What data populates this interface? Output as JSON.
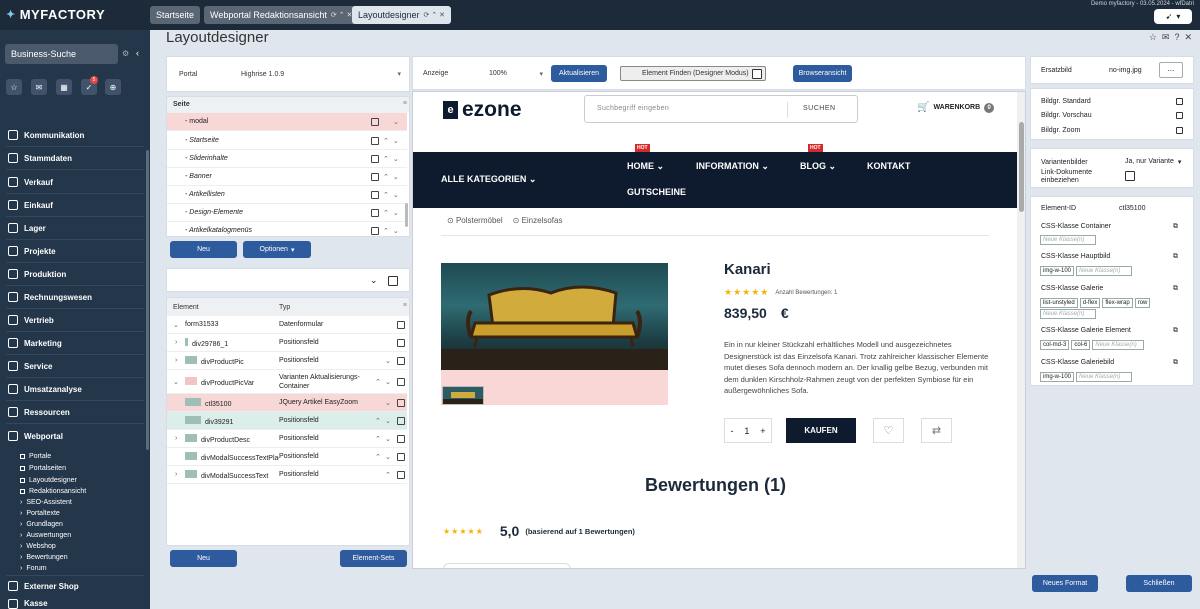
{
  "app": {
    "brand": "MYFACTORY",
    "demo_text": "Demo myfactory - 03.05.2024 - wfDatri"
  },
  "tabs": [
    {
      "label": "Startseite"
    },
    {
      "label": "Webportal Redaktionsansicht"
    },
    {
      "label": "Layoutdesigner"
    }
  ],
  "sidebar": {
    "search": "Business-Suche",
    "badge": "5",
    "items": [
      {
        "label": "Kommunikation"
      },
      {
        "label": "Stammdaten"
      },
      {
        "label": "Verkauf"
      },
      {
        "label": "Einkauf"
      },
      {
        "label": "Lager"
      },
      {
        "label": "Projekte"
      },
      {
        "label": "Produktion"
      },
      {
        "label": "Rechnungswesen"
      },
      {
        "label": "Vertrieb"
      },
      {
        "label": "Marketing"
      },
      {
        "label": "Service"
      },
      {
        "label": "Umsatzanalyse"
      },
      {
        "label": "Ressourcen"
      },
      {
        "label": "Webportal"
      }
    ],
    "subitems": [
      {
        "label": "Portale"
      },
      {
        "label": "Portalseiten"
      },
      {
        "label": "Layoutdesigner"
      },
      {
        "label": "Redaktionsansicht"
      },
      {
        "label": "SEO-Assistent"
      },
      {
        "label": "Portaltexte"
      },
      {
        "label": "Grundlagen"
      },
      {
        "label": "Auswertungen"
      },
      {
        "label": "Webshop"
      },
      {
        "label": "Bewertungen"
      },
      {
        "label": "Forum"
      }
    ],
    "extern": "Externer Shop",
    "last": "Kasse"
  },
  "page_title": "Layoutdesigner",
  "portal": {
    "label": "Portal",
    "value": "Highrise 1.0.9"
  },
  "anzeige": {
    "label": "Anzeige",
    "value": "100%",
    "refresh": "Aktualisieren",
    "find": "Element Finden (Designer Modus)",
    "browser": "Browseransicht"
  },
  "seite": {
    "header": "Seite",
    "rows": [
      {
        "label": "- modal"
      },
      {
        "label": "- Startseite"
      },
      {
        "label": "- Sliderinhalte"
      },
      {
        "label": "- Banner"
      },
      {
        "label": "- Artikellisten"
      },
      {
        "label": "- Design-Elemente"
      },
      {
        "label": "- Artikelkatalogmenüs"
      }
    ],
    "neu": "Neu",
    "optionen": "Optionen"
  },
  "elements": {
    "col_element": "Element",
    "col_typ": "Typ",
    "rows": [
      {
        "name": "form31533",
        "typ": "Datenformular"
      },
      {
        "name": "div29786_1",
        "typ": "Positionsfeld"
      },
      {
        "name": "divProductPic",
        "typ": "Positionsfeld"
      },
      {
        "name": "divProductPicVar",
        "typ": "Varianten Aktualisierungs-Container"
      },
      {
        "name": "ctl35100",
        "typ": "JQuery Artikel EasyZoom"
      },
      {
        "name": "div39291",
        "typ": "Positionsfeld"
      },
      {
        "name": "divProductDesc",
        "typ": "Positionsfeld"
      },
      {
        "name": "divModalSuccessTextPlace",
        "typ": "Positionsfeld"
      },
      {
        "name": "divModalSuccessText",
        "typ": "Positionsfeld"
      }
    ],
    "neu": "Neu",
    "sets": "Element-Sets"
  },
  "shop": {
    "logo": "ezone",
    "search_placeholder": "Suchbegriff eingeben",
    "search_btn": "SUCHEN",
    "cart": "WARENKORB",
    "cart_count": "0",
    "nav_all": "ALLE KATEGORIEN",
    "nav_home": "HOME",
    "nav_info": "INFORMATION",
    "nav_blog": "BLOG",
    "nav_kontakt": "KONTAKT",
    "nav_gutscheine": "GUTSCHEINE",
    "hot": "HOT",
    "crumb1": "Polstermöbel",
    "crumb2": "Einzelsofas",
    "product": "Kanari",
    "ratings": "Anzahl Bewertungen: 1",
    "price": "839,50",
    "currency": "€",
    "desc": "Ein in nur kleiner Stückzahl erhältliches Modell und ausgezeichnetes Designerstück ist das Einzelsofa Kanari. Trotz zahlreicher klassischer Elemente mutet dieses Sofa dennoch modern an. Der knallig gelbe Bezug, verbunden mit dem dunklen Kirschholz-Rahmen zeugt von der perfekten Symbiose für ein außergewöhnliches Sofa.",
    "qty": "1",
    "buy": "KAUFEN",
    "reviews_title": "Bewertungen (1)",
    "score": "5,0",
    "score_note": "(basierend auf 1 Bewertungen)"
  },
  "right": {
    "ersatzbild": "Ersatzbild",
    "ersatzbild_val": "no-img.jpg",
    "dots": "...",
    "bild_standard": "Bildgr. Standard",
    "bild_vorschau": "Bildgr. Vorschau",
    "bild_zoom": "Bildgr. Zoom",
    "variantenbilder": "Variantenbilder",
    "varianten_val": "Ja, nur Variante",
    "linkdok": "Link-Dokumente einbeziehen",
    "elementid": "Element-ID",
    "elementid_val": "ctl35100",
    "css_container": "CSS-Klasse Container",
    "css_haupt": "CSS-Klasse Hauptbild",
    "css_galerie": "CSS-Klasse Galerie",
    "css_galerie_el": "CSS-Klasse Galerie Element",
    "css_galeriebild": "CSS-Klasse Galeriebild",
    "neue_klasse": "Neue Klasse(n)",
    "chip_imgw100": "img-w-100",
    "chip_listunstyled": "list-unstyled",
    "chip_dflex": "d-flex",
    "chip_flexwrap": "flex-wrap",
    "chip_row": "row",
    "chip_colmd3": "col-md-3",
    "chip_col6": "col-6",
    "neues_format": "Neues Format",
    "schliessen": "Schließen"
  }
}
